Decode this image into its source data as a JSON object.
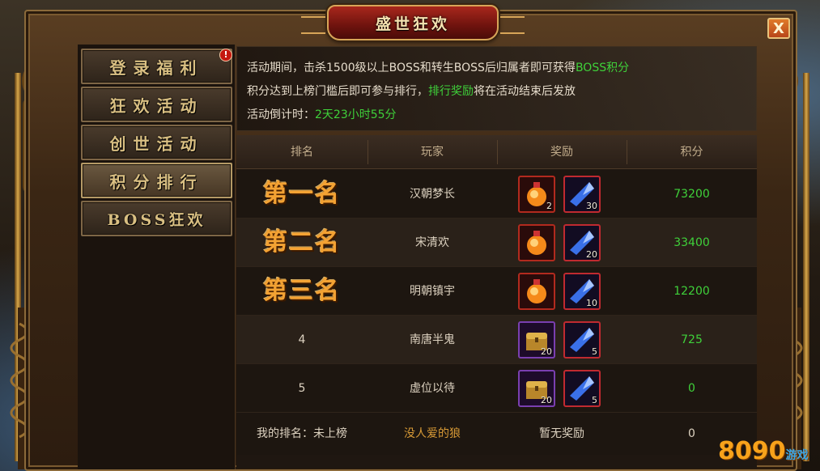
{
  "window": {
    "title": "盛世狂欢"
  },
  "close_label": "X",
  "sidebar": {
    "items": [
      {
        "label": "登录福利",
        "active": false,
        "notice": "!"
      },
      {
        "label": "狂欢活动",
        "active": false
      },
      {
        "label": "创世活动",
        "active": false
      },
      {
        "label": "积分排行",
        "active": true
      },
      {
        "label": "BOSS狂欢",
        "active": false
      }
    ]
  },
  "info": {
    "line1_pre": "活动期间，击杀1500级以上BOSS和转生BOSS后归属者即可获得",
    "line1_hl": "BOSS积分",
    "line2_pre": "积分达到上榜门槛后即可参与排行，",
    "line2_hl": "排行奖励",
    "line2_post": "将在活动结束后发放",
    "line3_pre": "活动倒计时：",
    "line3_hl": "2天23小时55分"
  },
  "table": {
    "headers": [
      "排名",
      "玩家",
      "奖励",
      "积分"
    ],
    "rows": [
      {
        "rank": "第一名",
        "player": "汉朝梦长",
        "score": "73200",
        "rewards": [
          {
            "icon": "potion-icon",
            "count": "2"
          },
          {
            "icon": "crystal-icon",
            "count": "30"
          }
        ]
      },
      {
        "rank": "第二名",
        "player": "宋清欢",
        "score": "33400",
        "rewards": [
          {
            "icon": "potion-icon",
            "count": ""
          },
          {
            "icon": "crystal-icon",
            "count": "20"
          }
        ]
      },
      {
        "rank": "第三名",
        "player": "明朝镇宇",
        "score": "12200",
        "rewards": [
          {
            "icon": "potion-icon",
            "count": ""
          },
          {
            "icon": "crystal-icon",
            "count": "10"
          }
        ]
      },
      {
        "rank": "4",
        "player": "南唐半鬼",
        "score": "725",
        "rewards": [
          {
            "icon": "treasure-chest-icon",
            "count": "20"
          },
          {
            "icon": "crystal-icon",
            "count": "5"
          }
        ]
      },
      {
        "rank": "5",
        "player": "虚位以待",
        "score": "0",
        "rewards": [
          {
            "icon": "treasure-chest-icon",
            "count": "20"
          },
          {
            "icon": "crystal-icon",
            "count": "5"
          }
        ]
      }
    ],
    "my_row": {
      "rank_label": "我的排名：未上榜",
      "player": "没人爱的狼",
      "reward": "暂无奖励",
      "score": "0"
    }
  },
  "watermark": {
    "main": "8090",
    "sub": "游戏"
  },
  "colors": {
    "green": "#3fd13a",
    "gold": "#f3a233",
    "frame": "#8b6a3a"
  }
}
